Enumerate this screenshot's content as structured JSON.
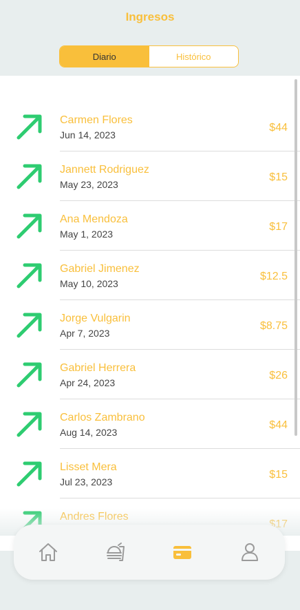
{
  "header": {
    "title": "Ingresos"
  },
  "tabs": [
    {
      "label": "Diario",
      "active": true
    },
    {
      "label": "Histórico",
      "active": false
    }
  ],
  "colors": {
    "accent": "#f9bf3b",
    "income_arrow": "#2ecc71",
    "nav_icon": "#9a9a9a"
  },
  "transactions": [
    {
      "name": "Carmen Flores",
      "date": "Jun 14, 2023",
      "amount": "$44",
      "icon": "arrow-up-right-icon"
    },
    {
      "name": "Jannett Rodriguez",
      "date": "May 23, 2023",
      "amount": "$15",
      "icon": "arrow-up-right-icon"
    },
    {
      "name": "Ana Mendoza",
      "date": "May 1, 2023",
      "amount": "$17",
      "icon": "arrow-up-right-icon"
    },
    {
      "name": "Gabriel Jimenez",
      "date": "May 10, 2023",
      "amount": "$12.5",
      "icon": "arrow-up-right-icon"
    },
    {
      "name": "Jorge Vulgarin",
      "date": "Apr 7, 2023",
      "amount": "$8.75",
      "icon": "arrow-up-right-icon"
    },
    {
      "name": "Gabriel Herrera",
      "date": "Apr 24, 2023",
      "amount": "$26",
      "icon": "arrow-up-right-icon"
    },
    {
      "name": "Carlos Zambrano",
      "date": "Aug 14, 2023",
      "amount": "$44",
      "icon": "arrow-up-right-icon"
    },
    {
      "name": "Lisset Mera",
      "date": "Jul 23, 2023",
      "amount": "$15",
      "icon": "arrow-up-right-icon"
    },
    {
      "name": "Andres Flores",
      "date": "",
      "amount": "$17",
      "icon": "arrow-up-right-icon"
    }
  ],
  "nav": [
    {
      "icon": "home-icon",
      "active": false
    },
    {
      "icon": "food-icon",
      "active": false
    },
    {
      "icon": "card-icon",
      "active": true
    },
    {
      "icon": "user-icon",
      "active": false
    }
  ]
}
